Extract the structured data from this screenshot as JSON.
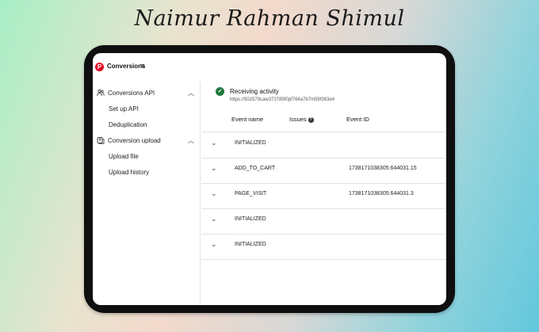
{
  "signature": "Naimur Rahman Shimul",
  "app": {
    "title": "Conversions",
    "menu_icon": "hamburger-icon"
  },
  "sidebar": {
    "sections": [
      {
        "label": "Conversions API",
        "icon": "people-icon",
        "items": [
          "Set up API",
          "Deduplication"
        ]
      },
      {
        "label": "Conversion upload",
        "icon": "upload-icon",
        "items": [
          "Upload file",
          "Upload history"
        ]
      }
    ]
  },
  "status": {
    "title": "Receiving activity",
    "url": "https://502579caw373785f0pf764a7b7m59f363e4"
  },
  "table": {
    "headers": {
      "event_name": "Event name",
      "issues": "Issues",
      "event_id": "Event ID"
    },
    "rows": [
      {
        "event_name": "INITIALIZED",
        "event_id": ""
      },
      {
        "event_name": "ADD_TO_CART",
        "event_id": "1738171038305.644031.15"
      },
      {
        "event_name": "PAGE_VISIT",
        "event_id": "1738171038305.644031.3"
      },
      {
        "event_name": "INITIALIZED",
        "event_id": ""
      },
      {
        "event_name": "INITIALIZED",
        "event_id": ""
      }
    ]
  },
  "colors": {
    "brand": "#e60023",
    "success": "#1f7a3d"
  }
}
